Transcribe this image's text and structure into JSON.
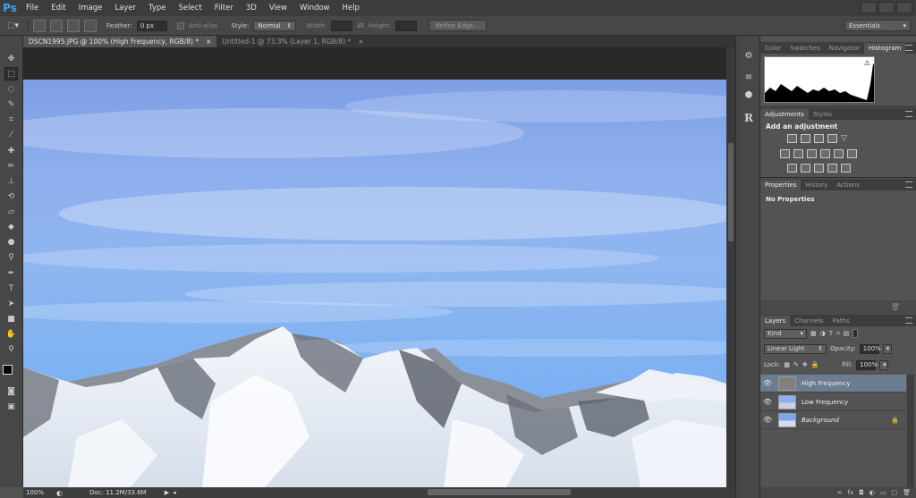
{
  "app": {
    "logo": "Ps"
  },
  "menu": [
    "File",
    "Edit",
    "Image",
    "Layer",
    "Type",
    "Select",
    "Filter",
    "3D",
    "View",
    "Window",
    "Help"
  ],
  "options": {
    "feather_label": "Feather:",
    "feather_value": "0 px",
    "antialias_label": "Anti-alias",
    "style_label": "Style:",
    "style_value": "Normal",
    "width_label": "Width:",
    "height_label": "Height:",
    "refine_label": "Refine Edge...",
    "workspace": "Essentials"
  },
  "tabs": [
    {
      "label": "DSCN1995.JPG @ 100% (High Frequency, RGB/8) *",
      "active": true
    },
    {
      "label": "Untitled-1 @ 73.3% (Layer 1, RGB/8) *",
      "active": false
    }
  ],
  "status": {
    "zoom": "100%",
    "doc": "Doc: 11.2M/33.6M"
  },
  "panels": {
    "histogram_tabs": [
      "Color",
      "Swatches",
      "Navigator",
      "Histogram"
    ],
    "adjustments_tabs": [
      "Adjustments",
      "Styles"
    ],
    "adjustments_title": "Add an adjustment",
    "properties_tabs": [
      "Properties",
      "History",
      "Actions"
    ],
    "properties_text": "No Properties",
    "layers_tabs": [
      "Layers",
      "Channels",
      "Paths"
    ],
    "kind_label": "Kind",
    "blend_mode": "Linear Light",
    "opacity_label": "Opacity:",
    "opacity_value": "100%",
    "lock_label": "Lock:",
    "fill_label": "Fill:",
    "fill_value": "100%",
    "layers": [
      {
        "name": "High Frequency",
        "selected": true,
        "italic": false
      },
      {
        "name": "Low Frequency",
        "selected": false,
        "italic": false
      },
      {
        "name": "Background",
        "selected": false,
        "italic": true
      }
    ]
  },
  "colors": {
    "accent": "#31a8ff",
    "selected_layer": "#6c7c91",
    "sky": "#8fb0ee"
  }
}
